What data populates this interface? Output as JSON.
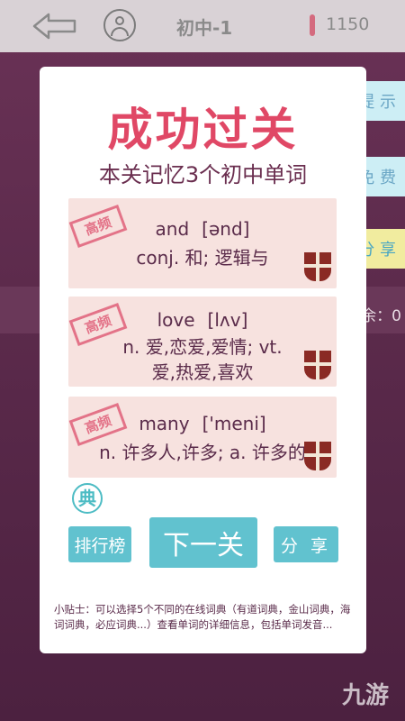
{
  "header": {
    "level": "初中-1",
    "coins": "1150"
  },
  "side_buttons": [
    "提 示",
    "免 费",
    "分 享"
  ],
  "remain_text": "余：0",
  "modal": {
    "title": "成功过关",
    "subtitle": "本关记忆3个初中单词",
    "stamp_label": "高频",
    "words": [
      {
        "word": "and",
        "phonetic": "[ənd]",
        "meaning_lines": [
          "conj. 和; 逻辑与"
        ]
      },
      {
        "word": "love",
        "phonetic": "[lʌv]",
        "meaning_lines": [
          "n. 爱,恋爱,爱情; vt.",
          "爱,热爱,喜欢"
        ]
      },
      {
        "word": "many",
        "phonetic": "['meni]",
        "meaning_lines": [
          "n. 许多人,许多; a. 许多的"
        ]
      }
    ],
    "dict_icon_label": "典",
    "buttons": {
      "rank": "排行榜",
      "next": "下一关",
      "share": "分 享"
    },
    "tip": "小贴士：可以选择5个不同的在线词典（有道词典，金山词典，海词词典，必应词典...）查看单词的详细信息，包括单词发音..."
  },
  "watermark": "九游",
  "colors": {
    "title": "#e04866",
    "button": "#61c2cf",
    "card": "#f7e2df",
    "background": "#5a2a4a"
  }
}
